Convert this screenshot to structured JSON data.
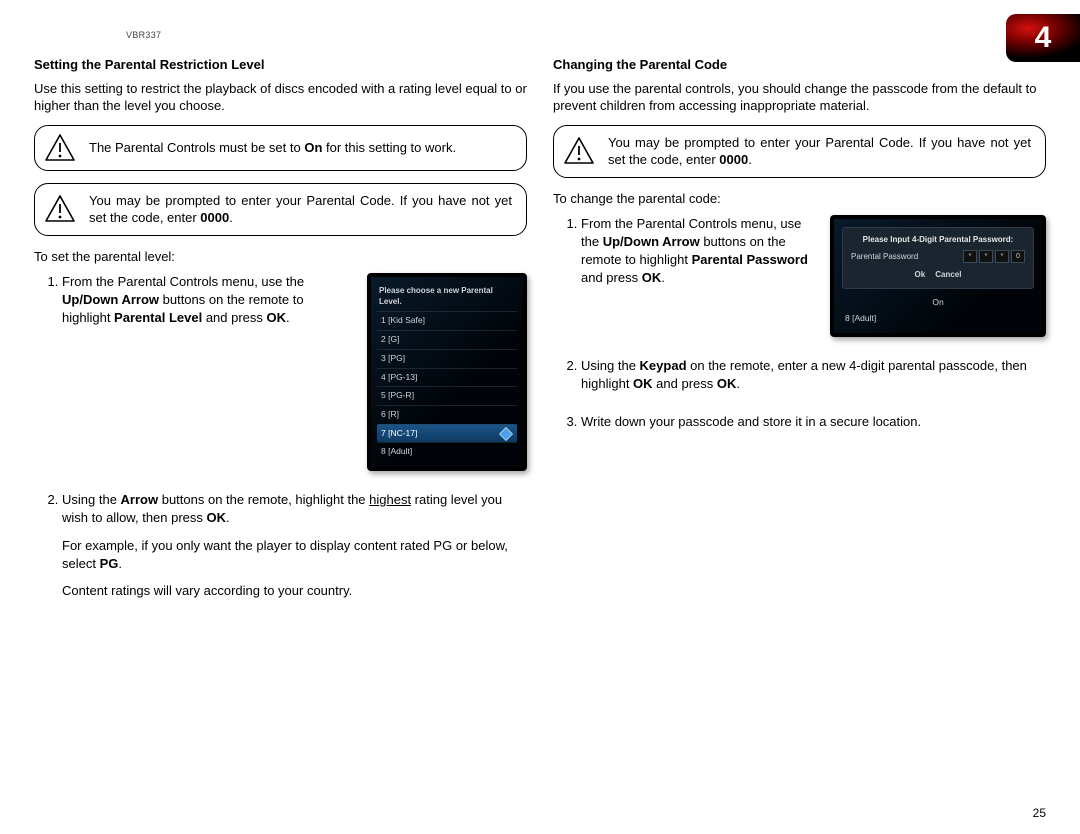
{
  "header": {
    "model": "VBR337",
    "chapter_number": "4"
  },
  "left": {
    "title": "Setting the Parental Restriction Level",
    "intro": "Use this setting to restrict the playback of discs encoded with a rating level equal to or higher than the level you choose.",
    "callout1": {
      "pre": "The Parental Controls must be set to ",
      "b": "On",
      "post": " for this setting to work."
    },
    "callout2": {
      "pre": "You may be prompted to enter your Parental Code. If you have not yet set the code, enter ",
      "b": "0000",
      "post": "."
    },
    "lead": "To set the parental level:",
    "step1": {
      "t1": "From the Parental Controls menu, use the ",
      "b1": "Up/Down Arrow",
      "t2": " buttons on the remote to highlight ",
      "b2": "Parental Level",
      "t3": " and press ",
      "b3": "OK",
      "t4": "."
    },
    "step2": {
      "t1": "Using the ",
      "b1": "Arrow",
      "t2": " buttons on the remote, highlight the ",
      "u": "highest",
      "t3": " rating level you wish to allow, then press ",
      "b2": "OK",
      "t4": "."
    },
    "step2_sub1": {
      "t1": "For example, if you only want the player to display content rated PG or below, select ",
      "b": "PG",
      "t2": "."
    },
    "step2_sub2": "Content ratings will vary according to your country.",
    "screen": {
      "title": "Please choose a new Parental Level.",
      "rows": [
        "1 [Kid Safe]",
        "2 [G]",
        "3 [PG]",
        "4 [PG-13]",
        "5 [PG-R]",
        "6 [R]",
        "7 [NC-17]",
        "8 [Adult]"
      ],
      "highlight_index": 6
    }
  },
  "right": {
    "title": "Changing the Parental Code",
    "intro": "If you use the parental controls, you should change the passcode from the default to prevent children from accessing inappropriate material.",
    "callout": {
      "pre": "You may be prompted to enter your Parental Code. If you have not yet set the code, enter ",
      "b": "0000",
      "post": "."
    },
    "lead": "To change the parental code:",
    "step1": {
      "t1": "From the Parental Controls menu, use the ",
      "b1": "Up/Down Arrow",
      "t2": " buttons on the remote to highlight ",
      "b2": "Parental Password",
      "t3": " and press ",
      "b3": "OK",
      "t4": "."
    },
    "step2": {
      "t1": "Using the ",
      "b1": "Keypad",
      "t2": " on the remote, enter a new 4-digit parental passcode, then highlight ",
      "b2": "OK",
      "t3": " and press ",
      "b3": "OK",
      "t4": "."
    },
    "step3": "Write down your passcode and store it in a secure location.",
    "screen": {
      "dialog_title": "Please Input 4-Digit Parental Password:",
      "row_label": "Parental Password",
      "boxes": [
        "*",
        "*",
        "*",
        "0"
      ],
      "btn_ok": "Ok",
      "btn_cancel": "Cancel",
      "under_on": "On",
      "under_adult": "8 [Adult]"
    }
  },
  "page_number": "25"
}
